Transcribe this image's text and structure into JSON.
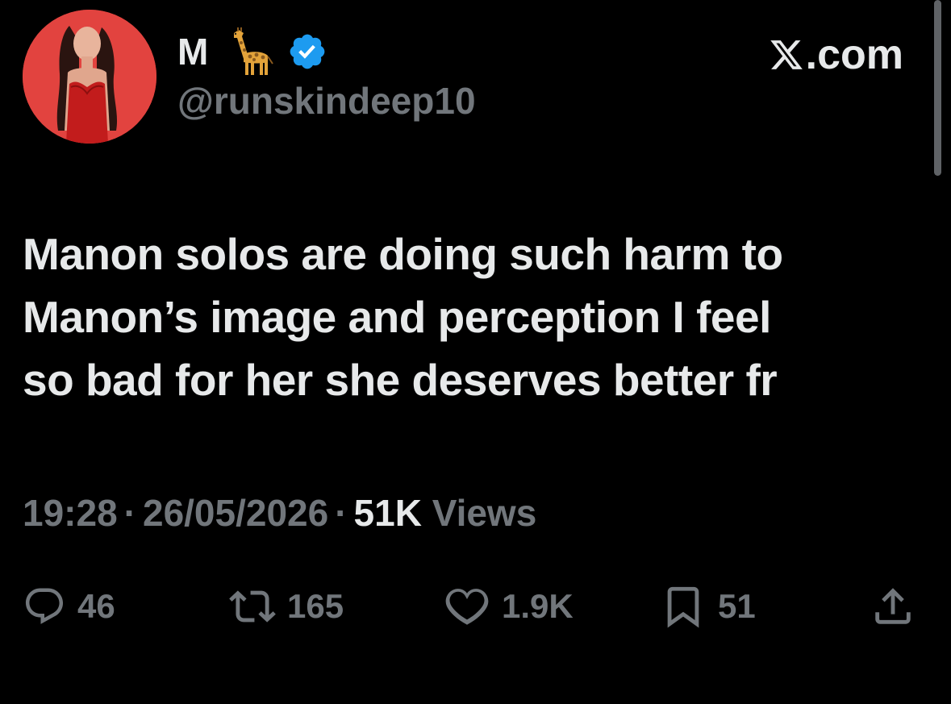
{
  "author": {
    "display_name": "M",
    "emoji_icon": "giraffe-emoji",
    "verified_icon": "verified-badge-icon",
    "handle": "@runskindeep10"
  },
  "source_label": ".com",
  "source_icon": "x-logo-icon",
  "tweet": {
    "lines": [
      "Manon solos are doing such harm to",
      "Manon’s image and perception I feel",
      "so bad for her she deserves better fr"
    ]
  },
  "meta": {
    "time": "19:28",
    "date": "26/05/2026",
    "views_count": "51K",
    "views_label": "Views"
  },
  "actions": {
    "replies": "46",
    "reposts": "165",
    "likes": "1.9K",
    "bookmarks": "51"
  },
  "colors": {
    "background": "#000000",
    "primary_text": "#e7e9ea",
    "secondary_text": "#71767b",
    "verified_blue": "#1d9bf0"
  }
}
